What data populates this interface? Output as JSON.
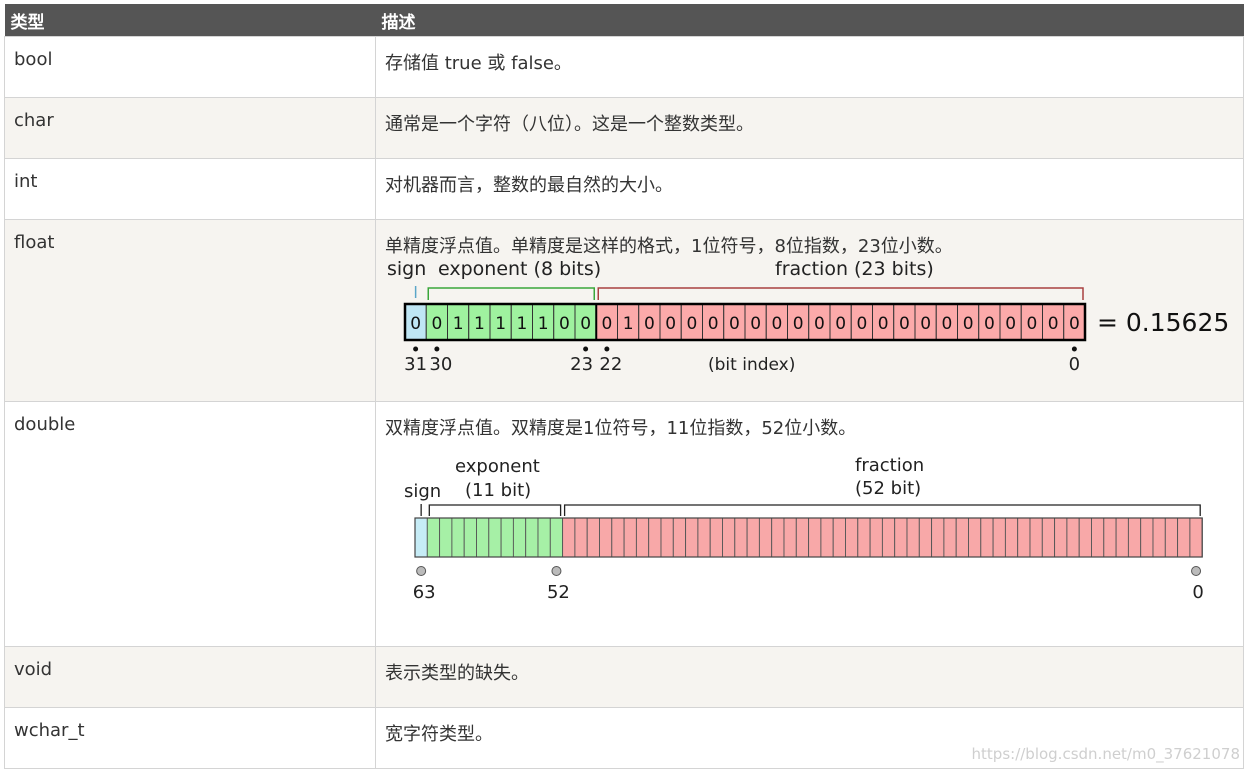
{
  "table": {
    "headers": [
      "类型",
      "描述"
    ],
    "rows": [
      {
        "type": "bool",
        "desc": "存储值 true 或 false。"
      },
      {
        "type": "char",
        "desc": "通常是一个字符（八位）。这是一个整数类型。"
      },
      {
        "type": "int",
        "desc": "对机器而言，整数的最自然的大小。"
      },
      {
        "type": "float",
        "desc": "单精度浮点值。单精度是这样的格式，1位符号，8位指数，23位小数。"
      },
      {
        "type": "double",
        "desc": "双精度浮点值。双精度是1位符号，11位指数，52位小数。"
      },
      {
        "type": "void",
        "desc": "表示类型的缺失。"
      },
      {
        "type": "wchar_t",
        "desc": "宽字符类型。"
      }
    ]
  },
  "float_diagram": {
    "sign_label": "sign",
    "exponent_label": "exponent (8 bits)",
    "fraction_label": "fraction (23 bits)",
    "bits": "00111110001000000000000000000000",
    "result": "= 0.15625",
    "index_labels": [
      "31",
      "30",
      "23",
      "22",
      "0"
    ],
    "bit_index_label": "(bit index)",
    "colors": {
      "sign": "#bfe6f4",
      "exponent": "#9ff29f",
      "fraction": "#fcaaaa"
    }
  },
  "double_diagram": {
    "sign_label": "sign",
    "exponent_label": "exponent",
    "exponent_sub": "(11 bit)",
    "fraction_label": "fraction",
    "fraction_sub": "(52 bit)",
    "total_bits": 64,
    "index_labels": [
      "63",
      "52",
      "0"
    ],
    "colors": {
      "sign": "#c6ecf6",
      "exponent": "#a6f0a6",
      "fraction": "#f8a8a8"
    }
  },
  "watermark": "https://blog.csdn.net/m0_37621078"
}
